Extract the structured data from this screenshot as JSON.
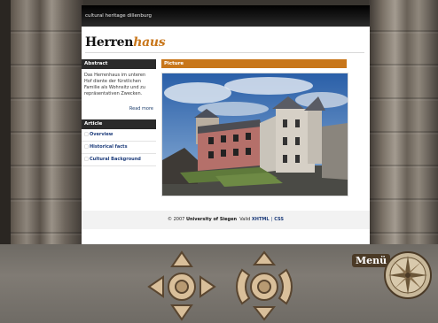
{
  "site": {
    "title": "cultural heritage dillenburg"
  },
  "logo": {
    "main": "Herren",
    "accent": "haus"
  },
  "abstract": {
    "heading": "Abstract",
    "text": "Das Herrenhaus im unteren Hof diente der fürstlichen Familie als Wohnsitz und zu repräsentativen Zwecken.",
    "read_more": "Read more"
  },
  "article": {
    "heading": "Article",
    "items": [
      {
        "label": "Overview"
      },
      {
        "label": "Historical facts"
      },
      {
        "label": "Cultural Background"
      }
    ]
  },
  "picture": {
    "heading": "Picture"
  },
  "footer": {
    "copyright": "© 2007",
    "org": "University of Siegen",
    "valid_label": "Valid",
    "xhtml": "XHTML",
    "css": "CSS"
  },
  "controls": {
    "menu_label": "Menü",
    "icons": [
      "move-arrows-icon",
      "rotate-arrows-icon",
      "compass-rose-icon"
    ]
  }
}
